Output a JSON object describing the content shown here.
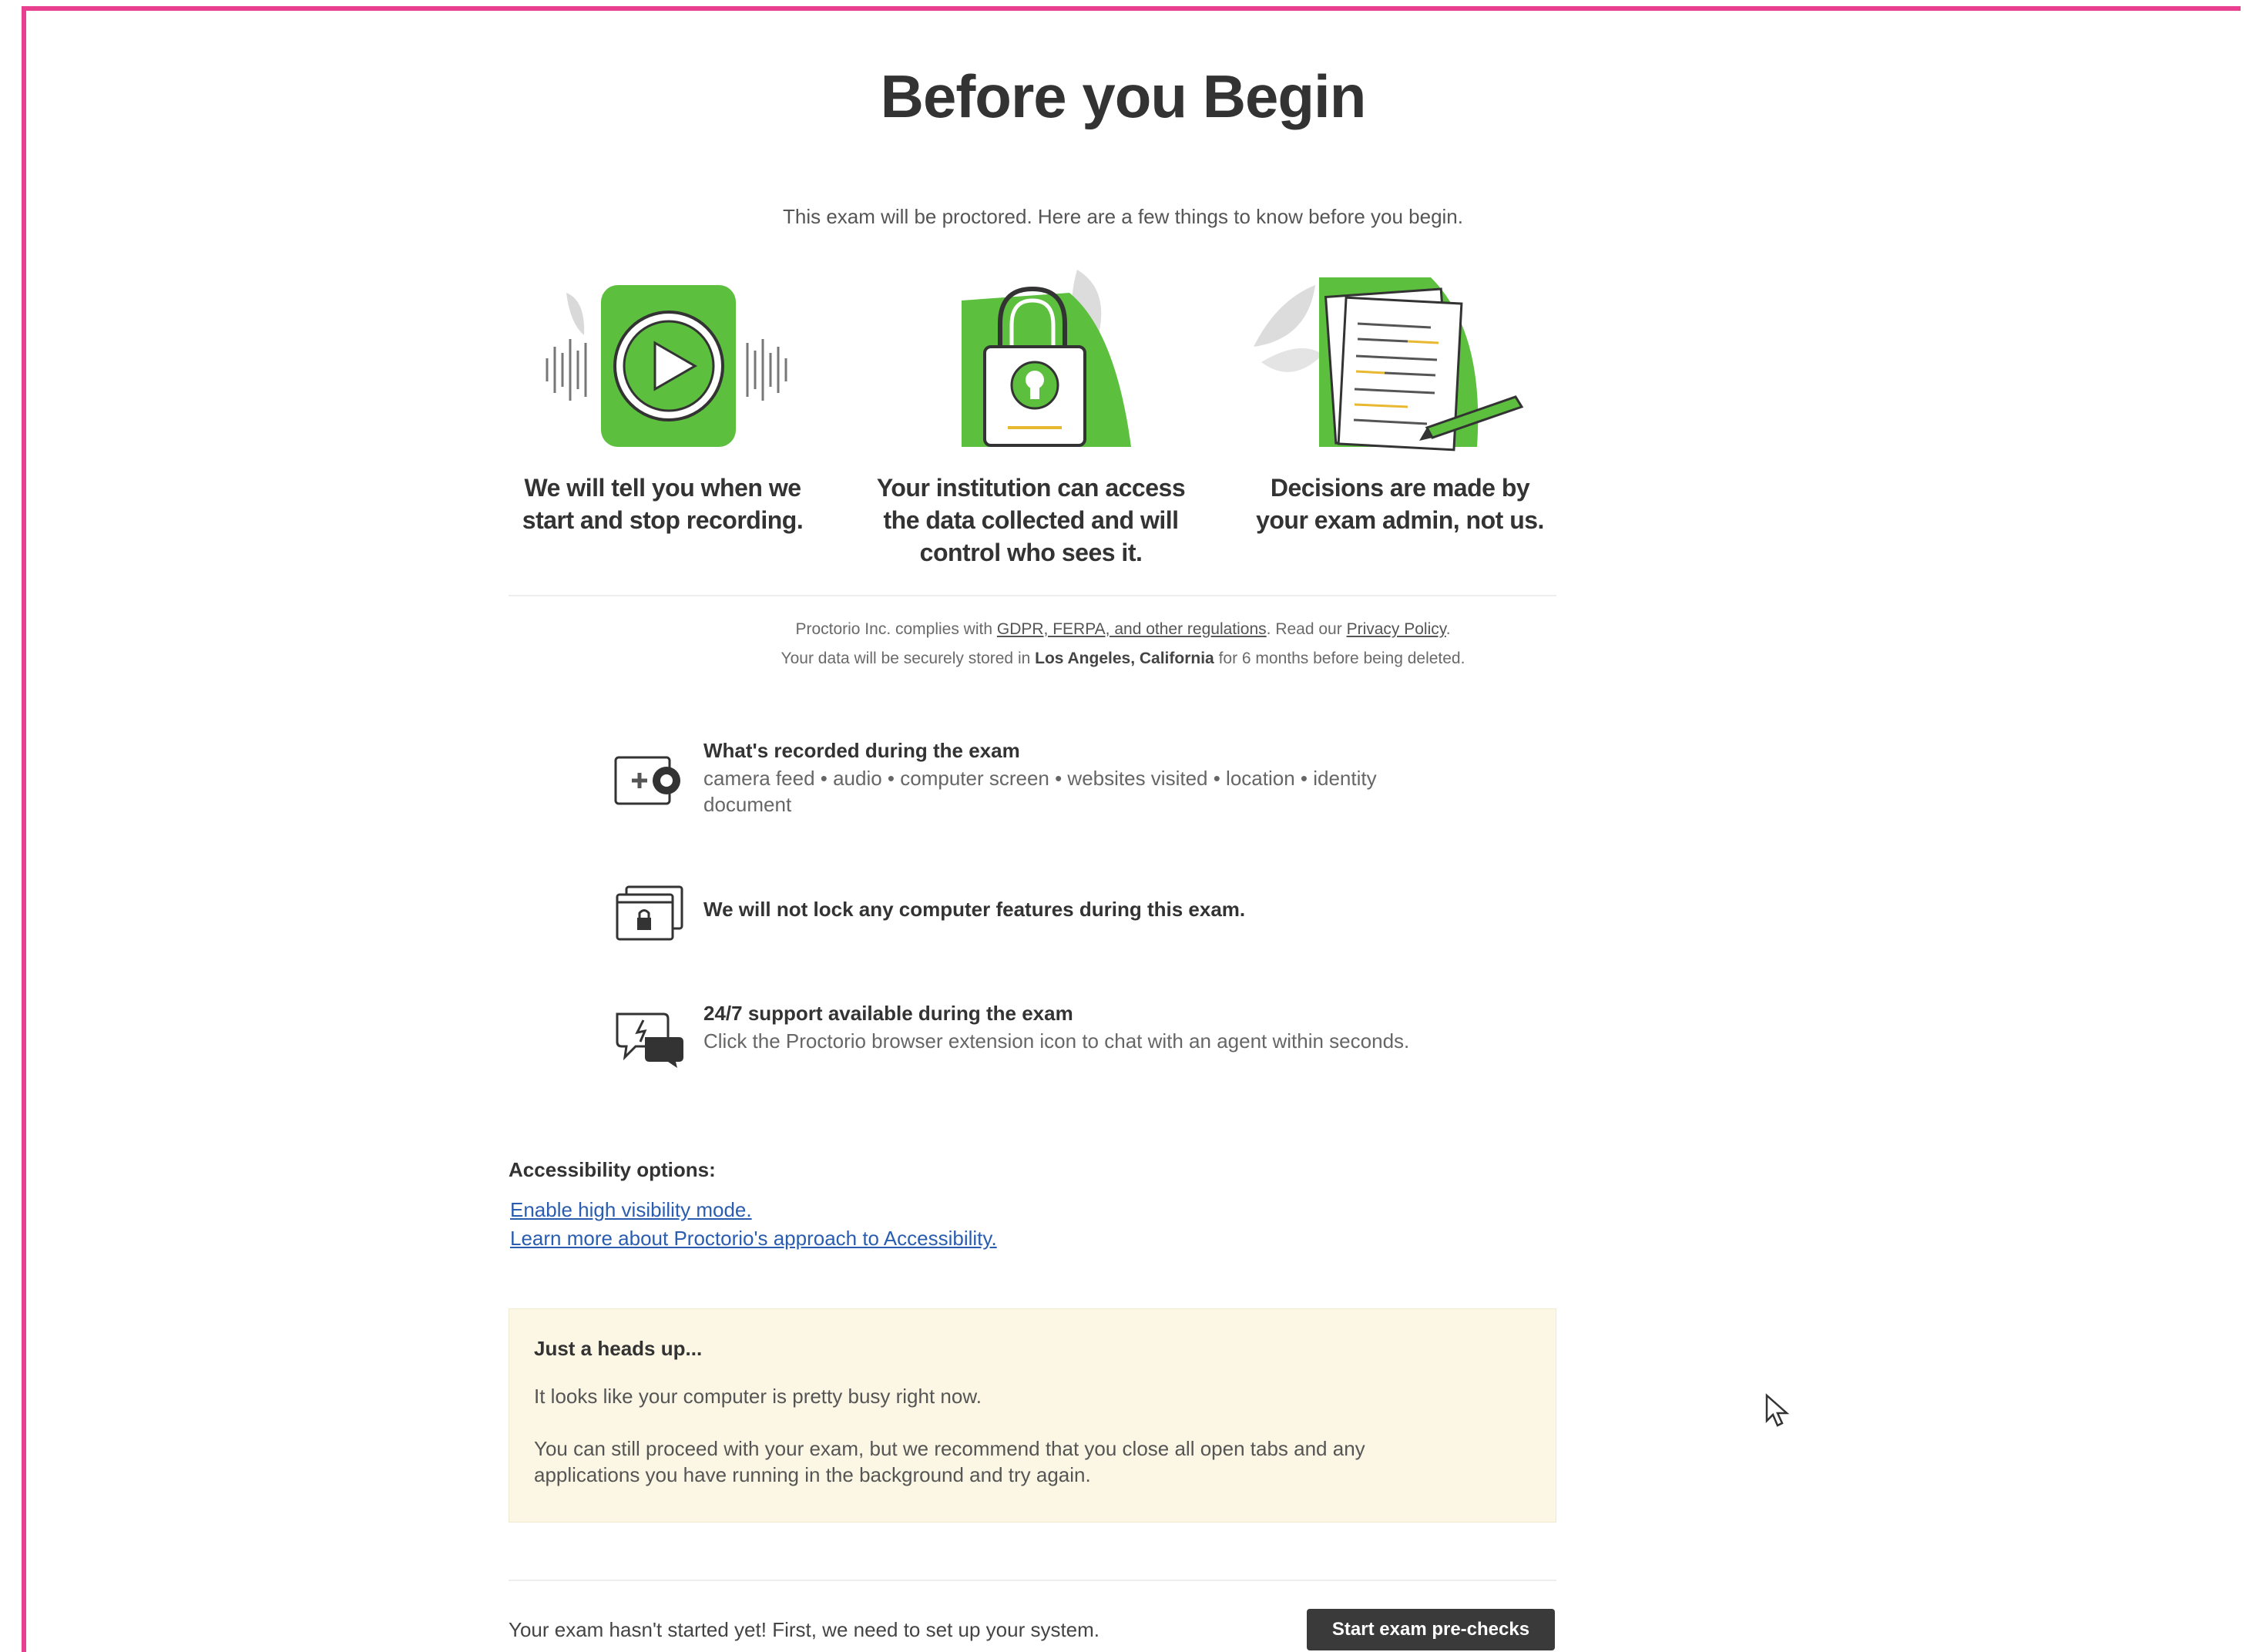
{
  "page": {
    "title": "Before you Begin",
    "subtitle": "This exam will be proctored. Here are a few things to know before you begin."
  },
  "columns": [
    {
      "icon": "play-recording-icon",
      "caption_line1": "We will tell you when we",
      "caption_line2": "start and stop recording."
    },
    {
      "icon": "padlock-icon",
      "caption_line1": "Your institution can access",
      "caption_line2": "the data collected and will",
      "caption_line3": "control who sees it."
    },
    {
      "icon": "document-pen-icon",
      "caption_line1": "Decisions are made by",
      "caption_line2": "your exam admin, not us."
    }
  ],
  "compliance": {
    "line1_prefix": "Proctorio Inc. complies with ",
    "gdpr_link": "GDPR, FERPA, and other regulations",
    "line1_mid": ". Read our ",
    "privacy_link": "Privacy Policy",
    "line1_suffix": ".",
    "line2_prefix": "Your data will be securely stored in ",
    "location": "Los Angeles, California",
    "line2_suffix": " for 6 months before being deleted."
  },
  "features": [
    {
      "icon": "camera-feed-icon",
      "title": "What's recorded during the exam",
      "desc": "camera feed • audio • computer screen • websites visited • location • identity document"
    },
    {
      "icon": "locked-window-icon",
      "title": "We will not lock any computer features during this exam.",
      "desc": ""
    },
    {
      "icon": "chat-support-icon",
      "title": "24/7 support available during the exam",
      "desc": "Click the Proctorio browser extension icon to chat with an agent within seconds."
    }
  ],
  "accessibility": {
    "title": "Accessibility options:",
    "link1": "Enable high visibility mode.",
    "link2": "Learn more about Proctorio's approach to Accessibility."
  },
  "heads_up": {
    "title": "Just a heads up...",
    "para1": "It looks like your computer is pretty busy right now.",
    "para2": "You can still proceed with your exam, but we recommend that you close all open tabs and any applications you have running in the background and try again."
  },
  "footer": {
    "text": "Your exam hasn't started yet! First, we need to set up your system.",
    "button_label": "Start exam pre-checks"
  },
  "colors": {
    "accent_green": "#5cbf3e",
    "frame_pink": "#e8408f",
    "link_blue": "#2a5db0",
    "button_dark": "#3a3a3a",
    "notice_bg": "#fbf7e4"
  }
}
